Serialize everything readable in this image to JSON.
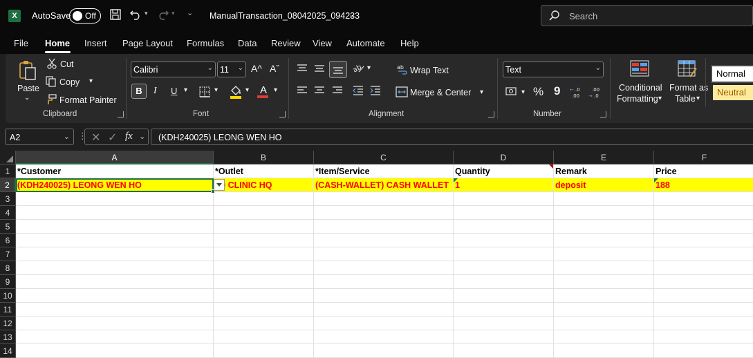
{
  "titlebar": {
    "app_logo": "X",
    "autosave_label": "AutoSave",
    "autosave_state": "Off",
    "filename": "ManualTransaction_08042025_094233",
    "search_placeholder": "Search",
    "icons": [
      "excel-icon",
      "save-icon",
      "undo-icon",
      "redo-icon",
      "chevron-down-icon",
      "search-icon"
    ]
  },
  "menu": {
    "tabs": [
      "File",
      "Home",
      "Insert",
      "Page Layout",
      "Formulas",
      "Data",
      "Review",
      "View",
      "Automate",
      "Help"
    ],
    "active": "Home"
  },
  "ribbon": {
    "clipboard": {
      "label": "Clipboard",
      "paste": "Paste",
      "cut": "Cut",
      "copy": "Copy",
      "format_painter": "Format Painter"
    },
    "font": {
      "label": "Font",
      "font_name": "Calibri",
      "font_size": "11",
      "bold": "B",
      "italic": "I",
      "underline": "U",
      "font_color_glyph": "A",
      "grow_glyph": "A^",
      "shrink_glyph": "Aˇ",
      "highlight_color": "#ffd700",
      "font_color": "#e03c31"
    },
    "alignment": {
      "label": "Alignment",
      "wrap_text": "Wrap Text",
      "merge_center": "Merge & Center"
    },
    "number": {
      "label": "Number",
      "format": "Text",
      "percent": "%",
      "comma": "9"
    },
    "styles": {
      "conditional_formatting": [
        "Conditional",
        "Formatting"
      ],
      "format_as_table": [
        "Format as",
        "Table"
      ],
      "normal": "Normal",
      "neutral": "Neutral"
    }
  },
  "formula_bar": {
    "name_box": "A2",
    "fx": "fx",
    "content": "(KDH240025) LEONG WEN HO"
  },
  "grid": {
    "columns": [
      "A",
      "B",
      "C",
      "D",
      "E",
      "F"
    ],
    "selected_column": "A",
    "rows": [
      "1",
      "2",
      "3",
      "4",
      "5",
      "6",
      "7",
      "8",
      "9",
      "10",
      "11",
      "12",
      "13",
      "14"
    ],
    "selected_row": "2",
    "header_row": [
      "*Customer",
      "*Outlet",
      "*Item/Service",
      "Quantity",
      "Remark",
      "Price"
    ],
    "data_row": [
      "(KDH240025) LEONG WEN HO",
      "UMO CLINIC HQ",
      "(CASH-WALLET) CASH WALLET",
      "1",
      "deposit",
      "188"
    ],
    "row2_fill": "#ffff00",
    "value_color": "#ff0000",
    "selection_color": "#217346"
  }
}
